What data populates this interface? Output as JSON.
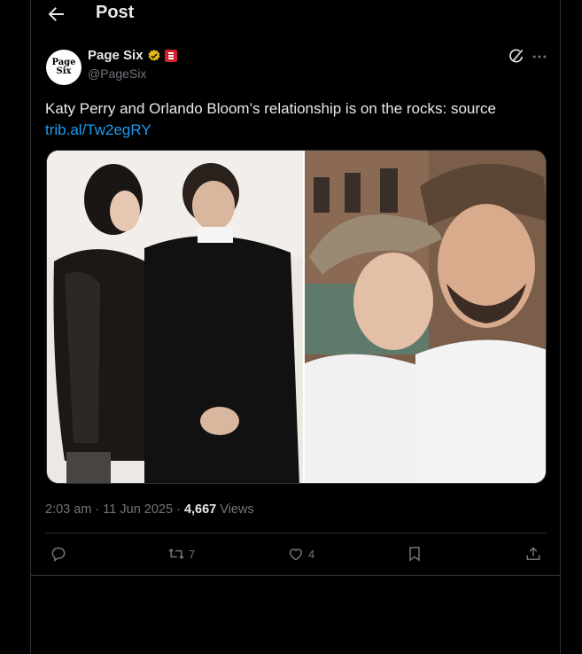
{
  "header": {
    "title": "Post"
  },
  "author": {
    "display_name": "Page Six",
    "handle": "@PageSix",
    "avatar_line1": "Page",
    "avatar_line2": "Six"
  },
  "tweet": {
    "text": "Katy Perry and Orlando Bloom’s relationship is on the rocks: source",
    "link": "trib.al/Tw2egRY"
  },
  "meta": {
    "time": "2:03 am",
    "dot1": " · ",
    "date": "11 Jun 2025",
    "dot2": " · ",
    "views_count": "4,667",
    "views_label": " Views"
  },
  "actions": {
    "reposts": "7",
    "likes": "4"
  },
  "colors": {
    "background": "#000000",
    "link": "#1d9bf0",
    "muted": "#71767b",
    "verified": "#e2b719",
    "affiliate": "#d3202a"
  },
  "icons": [
    "back-arrow-icon",
    "verified-badge-icon",
    "affiliate-badge-icon",
    "grok-icon",
    "more-icon",
    "reply-icon",
    "repost-icon",
    "like-icon",
    "bookmark-icon",
    "share-icon"
  ]
}
